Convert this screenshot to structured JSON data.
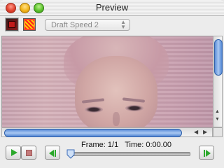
{
  "window": {
    "title": "Preview"
  },
  "toolbar": {
    "speed_value": "Draft Speed 2"
  },
  "playback": {
    "frame_label": "Frame:",
    "frame_value": "1/1",
    "time_label": "Time:",
    "time_value": "0:00.00",
    "position": 0
  },
  "icons": {
    "close": "close-icon",
    "minimize": "minimize-icon",
    "zoom": "zoom-icon",
    "mode_a": "solid-color-mode-icon",
    "mode_b": "pattern-mode-icon",
    "play": "play-icon",
    "stop": "stop-icon",
    "step_back": "step-back-icon",
    "step_forward": "step-forward-icon"
  },
  "colors": {
    "accent": "#2aa82a",
    "scroll_thumb": "#5c8ed8"
  }
}
